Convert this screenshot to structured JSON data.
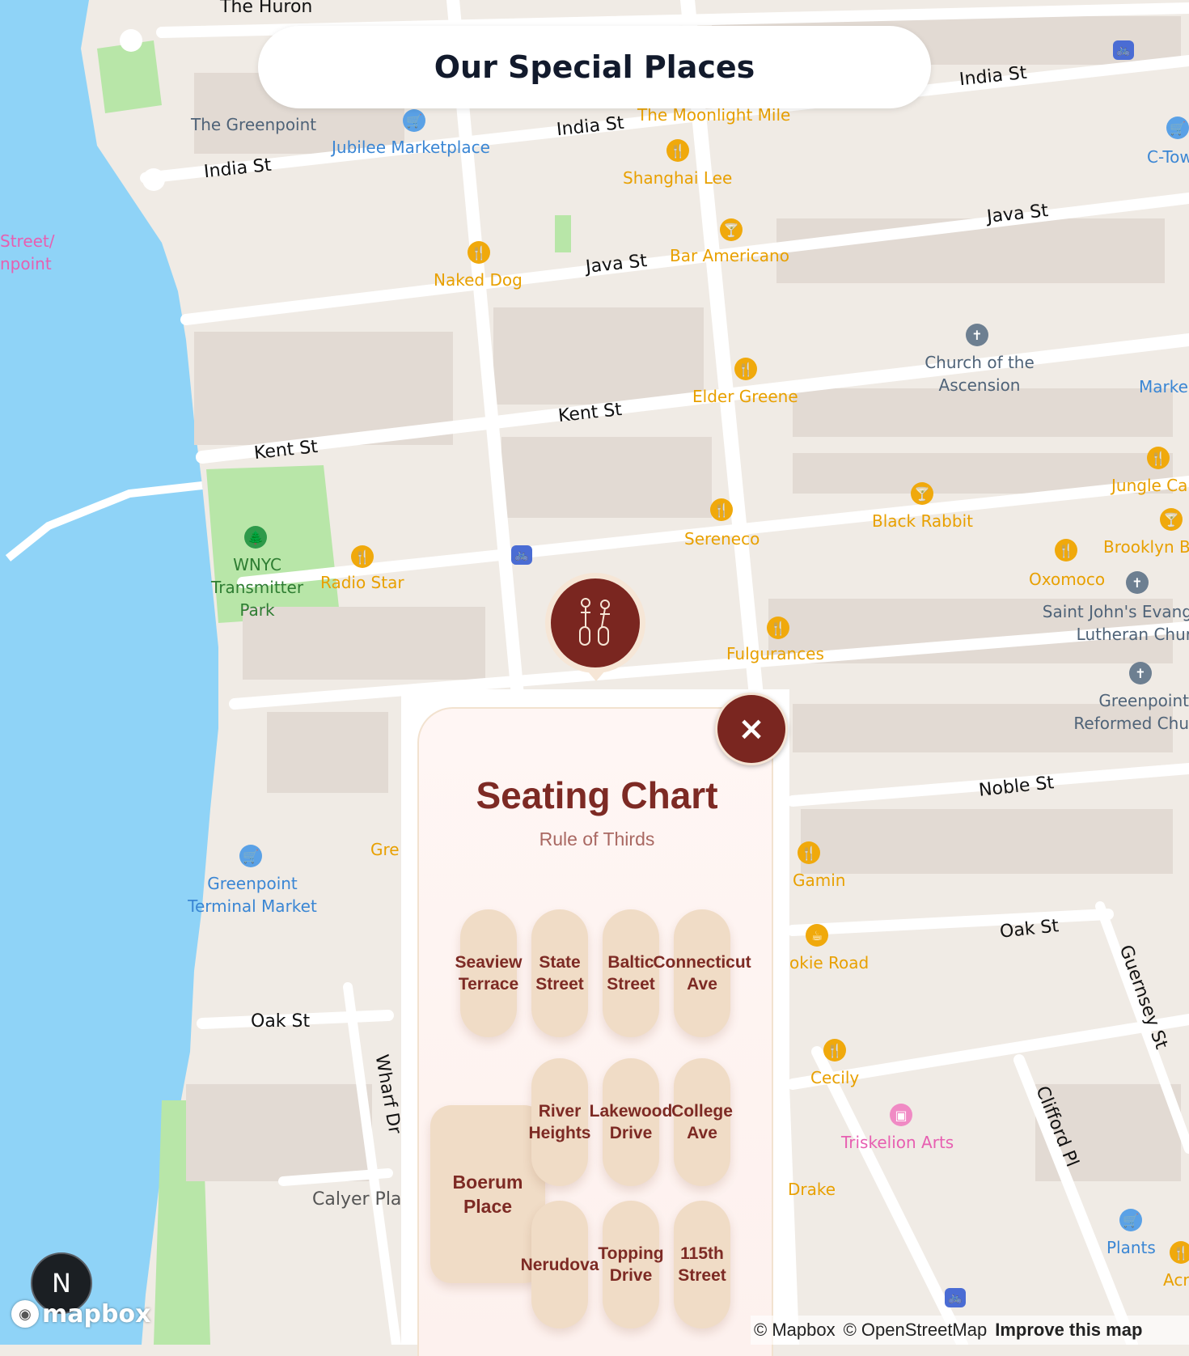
{
  "header": {
    "title": "Our Special Places"
  },
  "map": {
    "street_labels": [
      "The Huron",
      "India St",
      "India St",
      "India St",
      "Java St",
      "Java St",
      "Kent St",
      "Kent St",
      "Noble St",
      "Oak St",
      "Oak St",
      "Wharf Dr",
      "Guernsey St",
      "Clifford Pl",
      "Calyer Plac",
      "Street/",
      "npoint"
    ],
    "places": [
      {
        "name": "The Greenpoint",
        "kind": "neighborhood"
      },
      {
        "name": "Jubilee Marketplace",
        "kind": "shop",
        "icon": "shopping-cart-icon"
      },
      {
        "name": "The Moonlight Mile",
        "kind": "bar"
      },
      {
        "name": "Shanghai Lee",
        "kind": "restaurant",
        "icon": "restaurant-icon"
      },
      {
        "name": "Bar Americano",
        "kind": "bar",
        "icon": "cocktail-icon"
      },
      {
        "name": "Naked Dog",
        "kind": "restaurant",
        "icon": "restaurant-icon"
      },
      {
        "name": "C-Tow",
        "kind": "shop"
      },
      {
        "name": "Church of the Ascension",
        "kind": "church",
        "icon": "church-icon"
      },
      {
        "name": "Marke",
        "kind": "shop"
      },
      {
        "name": "Elder Greene",
        "kind": "restaurant",
        "icon": "restaurant-icon"
      },
      {
        "name": "Jungle Ca",
        "kind": "restaurant",
        "icon": "restaurant-icon"
      },
      {
        "name": "Black Rabbit",
        "kind": "bar",
        "icon": "cocktail-icon"
      },
      {
        "name": "Brooklyn B",
        "kind": "bar",
        "icon": "cocktail-icon"
      },
      {
        "name": "Oxomoco",
        "kind": "restaurant",
        "icon": "restaurant-icon"
      },
      {
        "name": "Sereneco",
        "kind": "restaurant",
        "icon": "restaurant-icon"
      },
      {
        "name": "Saint John's Evang Lutheran Chur",
        "kind": "church",
        "icon": "church-icon"
      },
      {
        "name": "WNYC Transmitter Park",
        "kind": "park",
        "icon": "tree-icon"
      },
      {
        "name": "Radio Star",
        "kind": "restaurant",
        "icon": "restaurant-icon"
      },
      {
        "name": "Fulgurances",
        "kind": "restaurant",
        "icon": "restaurant-icon"
      },
      {
        "name": "Greenpoint Reformed Chu",
        "kind": "church",
        "icon": "church-icon"
      },
      {
        "name": "Gre",
        "kind": "restaurant"
      },
      {
        "name": "Greenpoint Terminal Market",
        "kind": "shop",
        "icon": "shopping-cart-icon"
      },
      {
        "name": "Gamin",
        "kind": "restaurant",
        "icon": "restaurant-icon"
      },
      {
        "name": "okie Road",
        "kind": "cafe",
        "icon": "coffee-icon"
      },
      {
        "name": "Cecily",
        "kind": "restaurant",
        "icon": "restaurant-icon"
      },
      {
        "name": "Triskelion Arts",
        "kind": "arts",
        "icon": "gallery-icon"
      },
      {
        "name": "Drake",
        "kind": "restaurant"
      },
      {
        "name": "Plants",
        "kind": "shop",
        "icon": "shopping-cart-icon"
      },
      {
        "name": "Acr",
        "kind": "restaurant",
        "icon": "restaurant-icon"
      }
    ]
  },
  "popup": {
    "title": "Seating Chart",
    "subtitle": "Rule of Thirds",
    "close_label": "×",
    "seats": [
      {
        "label_1": "Seaview",
        "label_2": "Terrace"
      },
      {
        "label_1": "State",
        "label_2": "Street"
      },
      {
        "label_1": "Baltic",
        "label_2": "Street"
      },
      {
        "label_1": "Connecticut",
        "label_2": "Ave"
      },
      {
        "label_1": "River",
        "label_2": "Heights"
      },
      {
        "label_1": "Lakewood",
        "label_2": "Drive"
      },
      {
        "label_1": "College",
        "label_2": "Ave"
      },
      {
        "label_1": "Nerudova",
        "label_2": ""
      },
      {
        "label_1": "Topping",
        "label_2": "Drive"
      },
      {
        "label_1": "115th",
        "label_2": "Street"
      }
    ],
    "head_table": {
      "label_1": "Boerum",
      "label_2": "Place"
    }
  },
  "footer": {
    "n_badge": "N",
    "mapbox_logo": "mapbox",
    "attribution_mapbox": "© Mapbox",
    "attribution_osm": "© OpenStreetMap",
    "improve_link": "Improve this map"
  },
  "colors": {
    "accent": "#7a2620",
    "seat_fill": "#f0dcc6",
    "water": "#8fd3f7",
    "land": "#f0ebe5",
    "park": "#b8e6a8"
  }
}
